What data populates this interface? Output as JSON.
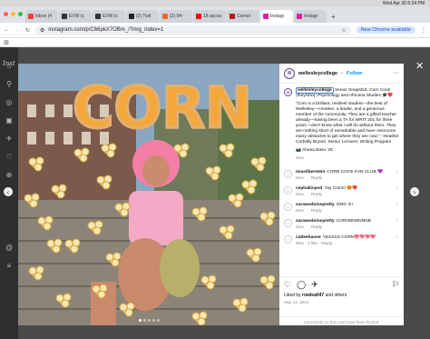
{
  "menubar": {
    "clock": "Wed Apr 30  6:34 PM"
  },
  "tabs": [
    {
      "label": "Inbox (4",
      "color": "#ea4335"
    },
    {
      "label": "EVW (c",
      "color": "#333333"
    },
    {
      "label": "EVW (c",
      "color": "#333333"
    },
    {
      "label": "(2) Twit",
      "color": "#222222"
    },
    {
      "label": "(2) 04-",
      "color": "#f26522"
    },
    {
      "label": "18 accou",
      "color": "#ff0000"
    },
    {
      "label": "Cornel",
      "color": "#b31b1b"
    },
    {
      "label": "Instagr",
      "color": "#d6249f",
      "active": true
    },
    {
      "label": "Instagr",
      "color": "#d6249f"
    }
  ],
  "address": {
    "url": "instagram.com/p/C66pkX7OBm_/?img_index=1",
    "chrome_badge": "New Chrome available"
  },
  "sidebar_icons": [
    "home-icon",
    "search-icon",
    "explore-icon",
    "reels-icon",
    "messages-icon",
    "heart-icon",
    "create-icon",
    "profile-icon"
  ],
  "instagram_logo": "Inst",
  "post": {
    "image_word": "CORN",
    "author": "wellesleycollege",
    "follow": "Follow",
    "caption_user": "wellesleycollege",
    "caption_intro": "Senior Snapshot: Corn Cook (they/she), Psychology and Africana Studies 🎓❤️",
    "caption_quote": "\"Corn is a brilliant, resilient student—the best of Wellesley—creative, a leader, and a generous member of the community. They are a gifted teacher already—having been a TA for WRIT 201 for three years. I don't know what I will do without them. They are nothing short of remarkable and have overcome many obstacles to get where they are now.\" –Heather Corbally Bryant, Senior Lecturer, Writing Program",
    "caption_tag": "📷 Ahana Basu '25",
    "caption_time": "51w",
    "comments": [
      {
        "user": "miasilberstein",
        "text": "CORN COOK FAN CLUB 💜",
        "time": "51w",
        "likes": ""
      },
      {
        "user": "cephaliicpod",
        "text": "Yay Corn!!! 😍❤️",
        "time": "51w",
        "likes": ""
      },
      {
        "user": "sarawodoinspretty",
        "text": "OMG !!!!",
        "time": "51w",
        "likes": ""
      },
      {
        "user": "sarawodoinspretty",
        "text": "CORNNNNNNNB",
        "time": "51w",
        "likes": ""
      },
      {
        "user": "catleehanne",
        "text": "YESSSS CORN💖💖💖💖",
        "time": "50w",
        "likes": "1 like"
      }
    ],
    "reply_label": "Reply",
    "liked_by_prefix": "Liked by ",
    "liked_by_user": "rowlea047",
    "liked_by_suffix": " and others",
    "date": "May 12, 2024",
    "comments_off": "Comments on this post have been limited."
  }
}
